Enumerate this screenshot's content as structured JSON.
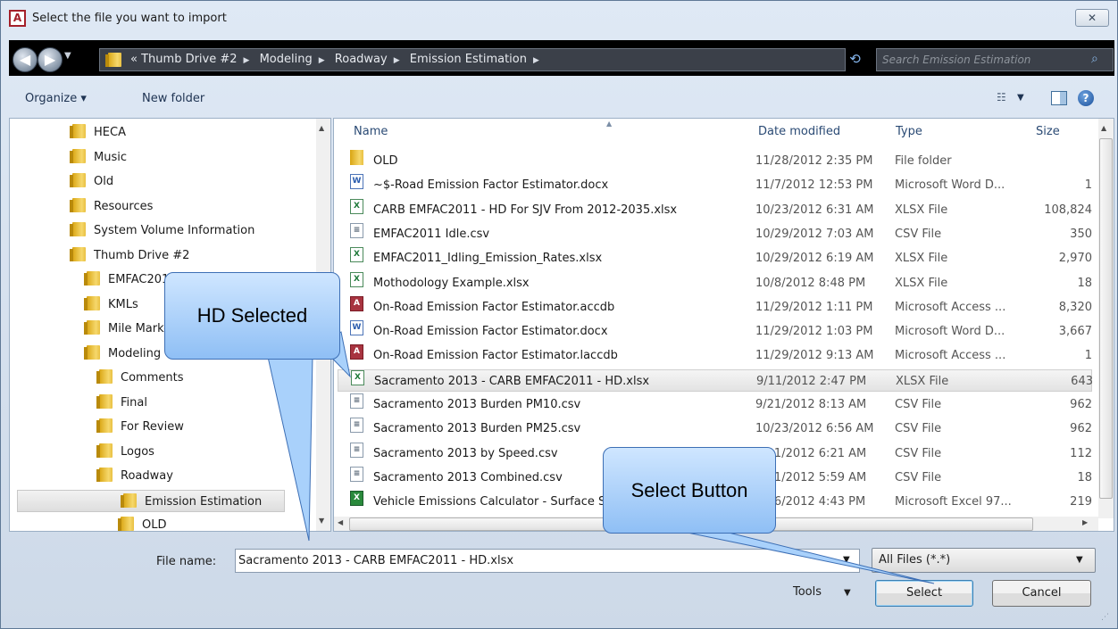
{
  "window": {
    "title": "Select the file you want to import",
    "app_icon_letter": "A",
    "close_glyph": "✕"
  },
  "address_bar": {
    "prefix": "«",
    "crumbs": [
      "Thumb Drive #2",
      "Modeling",
      "Roadway",
      "Emission Estimation"
    ],
    "search_placeholder": "Search Emission Estimation"
  },
  "toolbar": {
    "organize_label": "Organize ▾",
    "new_folder_label": "New folder"
  },
  "nav_pane": {
    "items": [
      {
        "label": "HECA",
        "indent": 0
      },
      {
        "label": "Music",
        "indent": 0
      },
      {
        "label": "Old",
        "indent": 0
      },
      {
        "label": "Resources",
        "indent": 0
      },
      {
        "label": "System Volume Information",
        "indent": 0
      },
      {
        "label": "Thumb Drive #2",
        "indent": 0
      },
      {
        "label": "EMFAC2011",
        "indent": 1
      },
      {
        "label": "KMLs",
        "indent": 1
      },
      {
        "label": "Mile Markers",
        "indent": 1
      },
      {
        "label": "Modeling",
        "indent": 1
      },
      {
        "label": "Comments",
        "indent": 2
      },
      {
        "label": "Final",
        "indent": 2
      },
      {
        "label": "For Review",
        "indent": 2
      },
      {
        "label": "Logos",
        "indent": 2
      },
      {
        "label": "Roadway",
        "indent": 2
      },
      {
        "label": "Emission Estimation",
        "indent": 3,
        "selected": true
      },
      {
        "label": "OLD",
        "indent": 4
      }
    ]
  },
  "file_list": {
    "columns": {
      "name": "Name",
      "date": "Date modified",
      "type": "Type",
      "size": "Size"
    },
    "rows": [
      {
        "icon": "folder",
        "name": "OLD",
        "date": "11/28/2012 2:35 PM",
        "type": "File folder",
        "size": ""
      },
      {
        "icon": "docx",
        "name": "~$-Road Emission Factor Estimator.docx",
        "date": "11/7/2012 12:53 PM",
        "type": "Microsoft Word D...",
        "size": "1"
      },
      {
        "icon": "xlsx",
        "name": "CARB EMFAC2011 - HD For SJV From 2012-2035.xlsx",
        "date": "10/23/2012 6:31 AM",
        "type": "XLSX File",
        "size": "108,824"
      },
      {
        "icon": "csv",
        "name": "EMFAC2011 Idle.csv",
        "date": "10/29/2012 7:03 AM",
        "type": "CSV File",
        "size": "350"
      },
      {
        "icon": "xlsx",
        "name": "EMFAC2011_Idling_Emission_Rates.xlsx",
        "date": "10/29/2012 6:19 AM",
        "type": "XLSX File",
        "size": "2,970"
      },
      {
        "icon": "xlsx",
        "name": "Mothodology Example.xlsx",
        "date": "10/8/2012 8:48 PM",
        "type": "XLSX File",
        "size": "18"
      },
      {
        "icon": "access",
        "name": "On-Road Emission Factor Estimator.accdb",
        "date": "11/29/2012 1:11 PM",
        "type": "Microsoft Access ...",
        "size": "8,320"
      },
      {
        "icon": "docx",
        "name": "On-Road Emission Factor Estimator.docx",
        "date": "11/29/2012 1:03 PM",
        "type": "Microsoft Word D...",
        "size": "3,667"
      },
      {
        "icon": "access",
        "name": "On-Road Emission Factor Estimator.laccdb",
        "date": "11/29/2012 9:13 AM",
        "type": "Microsoft Access ...",
        "size": "1"
      },
      {
        "icon": "xlsx",
        "name": "Sacramento 2013 - CARB EMFAC2011 - HD.xlsx",
        "date": "9/11/2012 2:47 PM",
        "type": "XLSX File",
        "size": "643",
        "selected": true
      },
      {
        "icon": "csv",
        "name": "Sacramento 2013 Burden PM10.csv",
        "date": "9/21/2012 8:13 AM",
        "type": "CSV File",
        "size": "962"
      },
      {
        "icon": "csv",
        "name": "Sacramento 2013 Burden PM25.csv",
        "date": "10/23/2012 6:56 AM",
        "type": "CSV File",
        "size": "962"
      },
      {
        "icon": "csv",
        "name": "Sacramento 2013 by Speed.csv",
        "date": "9/21/2012 6:21 AM",
        "type": "CSV File",
        "size": "112"
      },
      {
        "icon": "csv",
        "name": "Sacramento 2013 Combined.csv",
        "date": "9/21/2012 5:59 AM",
        "type": "CSV File",
        "size": "18"
      },
      {
        "icon": "xls",
        "name": "Vehicle Emissions Calculator - Surface Streets.xls",
        "date": "9/26/2012 4:43 PM",
        "type": "Microsoft Excel 97...",
        "size": "219"
      }
    ]
  },
  "footer": {
    "file_name_label": "File name:",
    "file_name_value": "Sacramento 2013 - CARB EMFAC2011 - HD.xlsx",
    "filter_value": "All Files (*.*)",
    "tools_label": "Tools",
    "select_label": "Select",
    "cancel_label": "Cancel"
  },
  "callouts": {
    "hd_selected": "HD Selected",
    "select_button": "Select Button"
  },
  "colors": {
    "callout_fill": "#a9d1fb",
    "callout_border": "#3d6fb5",
    "address_bar_bg": "#000000"
  }
}
